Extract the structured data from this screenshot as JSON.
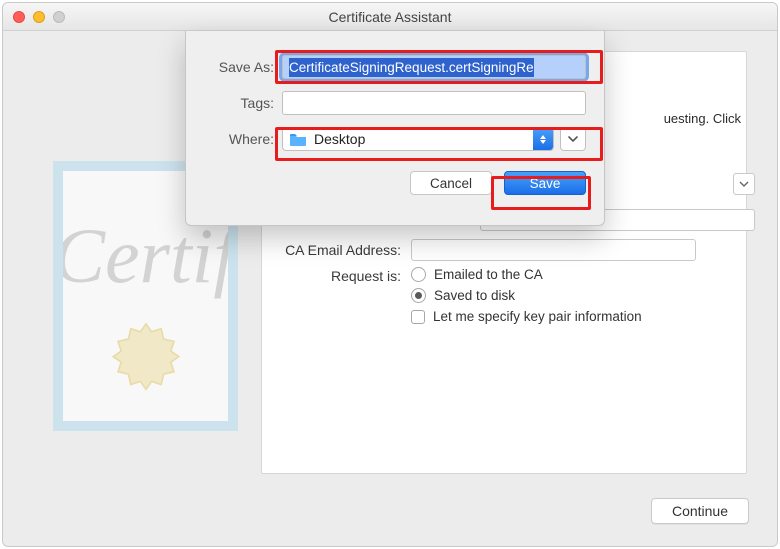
{
  "window": {
    "title": "Certificate Assistant"
  },
  "sheet": {
    "saveAsLabel": "Save As:",
    "saveAsValue": "CertificateSigningRequest.certSigningRe",
    "tagsLabel": "Tags:",
    "tagsValue": "",
    "whereLabel": "Where:",
    "whereValue": "Desktop",
    "cancelLabel": "Cancel",
    "saveLabel": "Save"
  },
  "assistant": {
    "infoFragment": "uesting. Click",
    "caEmailLabel": "CA Email Address:",
    "caEmailValue": "",
    "requestIsLabel": "Request is:",
    "radioEmailed": "Emailed to the CA",
    "radioSaved": "Saved to disk",
    "checkKeyPair": "Let me specify key pair information",
    "continueLabel": "Continue"
  },
  "certificateScript": "Certif"
}
